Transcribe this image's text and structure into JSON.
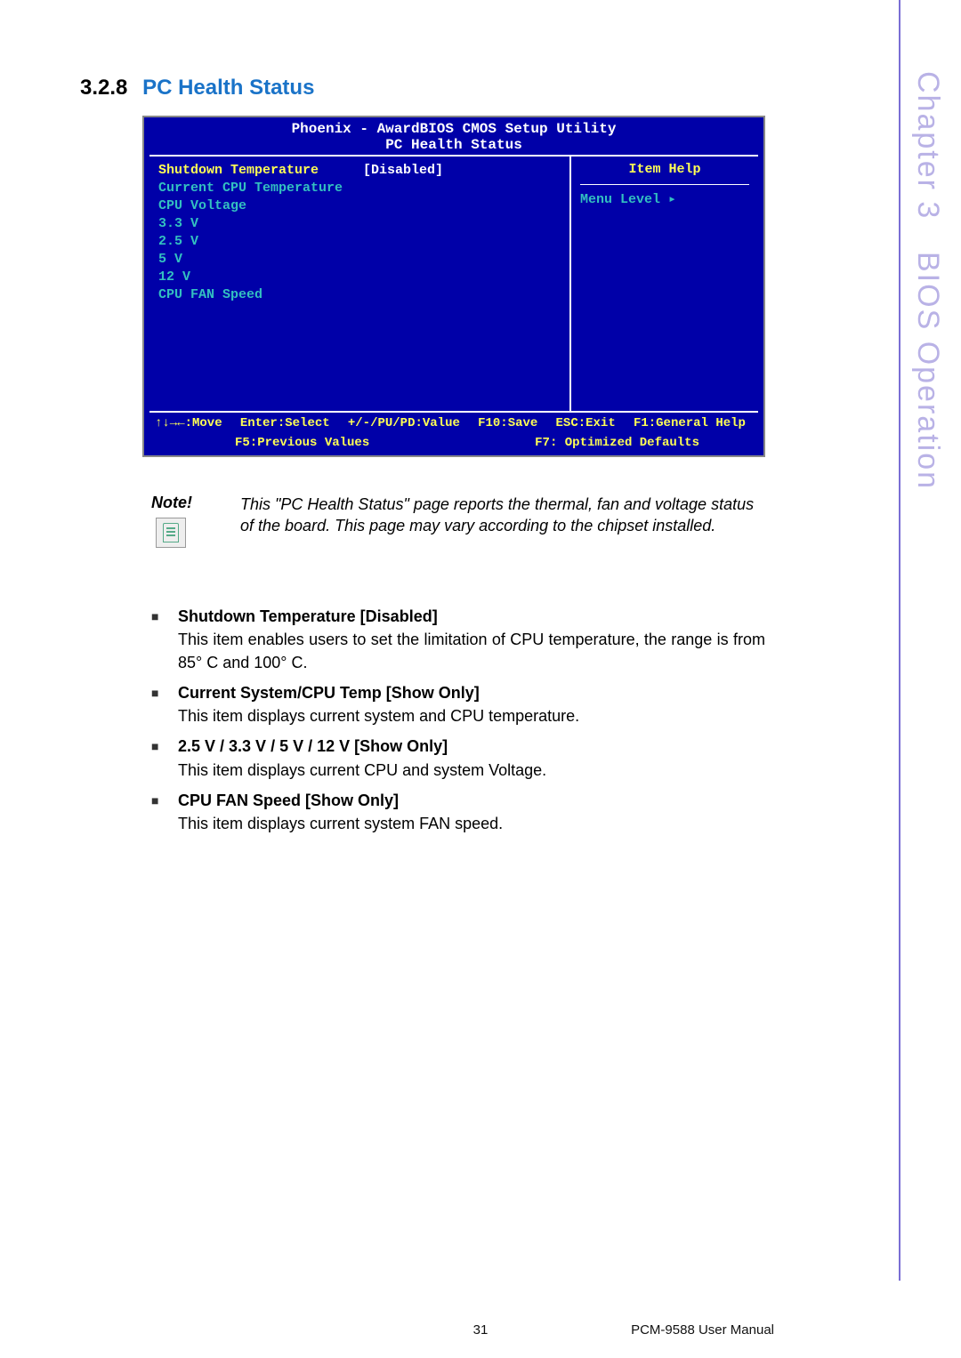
{
  "side": {
    "chapter": "Chapter 3",
    "title": "BIOS Operation"
  },
  "heading": {
    "num": "3.2.8",
    "title": "PC Health Status"
  },
  "bios": {
    "title": "Phoenix - AwardBIOS CMOS Setup Utility",
    "subtitle": "PC Health Status",
    "rows": [
      {
        "label": "Shutdown Temperature",
        "value": "[Disabled]",
        "readonly": false
      },
      {
        "label": "Current CPU Temperature",
        "value": "",
        "readonly": true
      },
      {
        "label": "CPU Voltage",
        "value": "",
        "readonly": true
      },
      {
        "label": "3.3 V",
        "value": "",
        "readonly": true
      },
      {
        "label": "2.5 V",
        "value": "",
        "readonly": true
      },
      {
        "label": "5 V",
        "value": "",
        "readonly": true
      },
      {
        "label": "12 V",
        "value": "",
        "readonly": true
      },
      {
        "label": "CPU FAN Speed",
        "value": "",
        "readonly": true
      }
    ],
    "help_header": "Item Help",
    "menu_level": "Menu Level   ▸",
    "footer": {
      "move": "↑↓→←:Move",
      "enter": "Enter:Select",
      "pupd": "+/-/PU/PD:Value",
      "f10": "F10:Save",
      "esc": "ESC:Exit",
      "f1": "F1:General Help",
      "f5": "F5:Previous Values",
      "f7": "F7: Optimized Defaults"
    }
  },
  "note": {
    "label": "Note!",
    "text": "This \"PC Health Status\" page reports the thermal, fan and voltage status of the board. This page may vary according to the chipset installed."
  },
  "items": [
    {
      "head": "Shutdown Temperature [Disabled]",
      "desc": "This item enables users to set the limitation of CPU temperature, the range is from 85° C and 100° C."
    },
    {
      "head": "Current System/CPU Temp [Show Only]",
      "desc": "This item displays current system and CPU temperature."
    },
    {
      "head": "2.5 V / 3.3 V / 5 V / 12 V [Show Only]",
      "desc": "This item displays current CPU and system Voltage."
    },
    {
      "head": "CPU FAN Speed [Show Only]",
      "desc": "This item displays current system FAN speed."
    }
  ],
  "footer": {
    "page": "31",
    "manual": "PCM-9588 User Manual"
  }
}
